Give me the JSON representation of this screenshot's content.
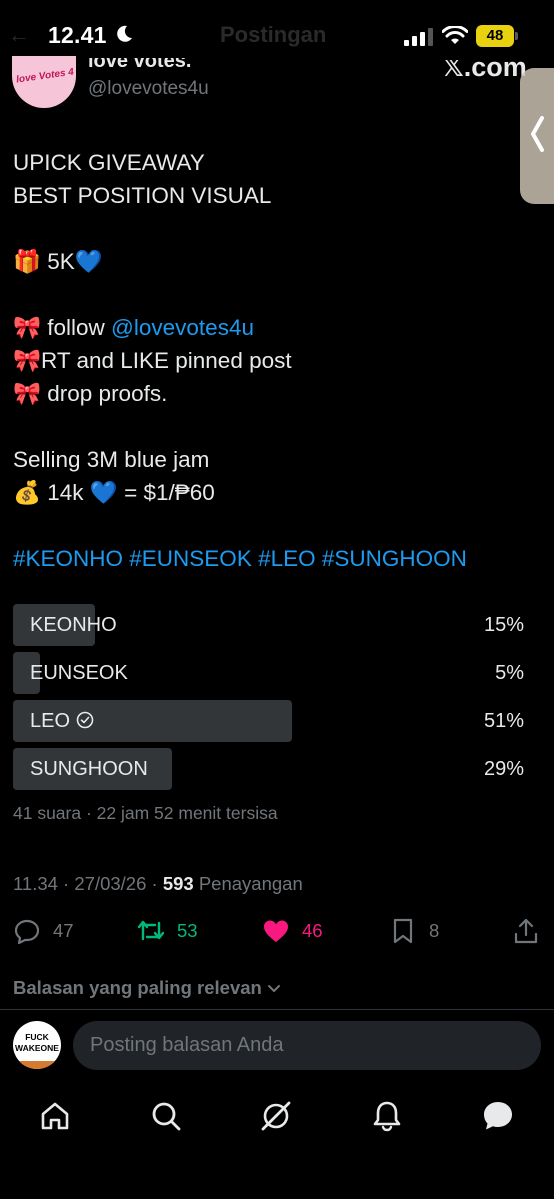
{
  "status_bar": {
    "time": "12.41",
    "battery": "48",
    "ghost_title": "Postingan"
  },
  "tweet_header": {
    "display_name": "love votes.",
    "handle": "@lovevotes4u",
    "avatar_text": "love Votes 4 u",
    "brand": "𝕏.com"
  },
  "tweet": {
    "line1": "UPICK GIVEAWAY",
    "line2": "BEST POSITION VISUAL",
    "prize": "🎁 5K",
    "prize_heart": "💙",
    "step1_prefix": "🎀 follow ",
    "step1_mention": "@lovevotes4u",
    "step2": "🎀RT and LIKE pinned post",
    "step3": "🎀 drop proofs.",
    "selling": "Selling 3M blue jam",
    "price_prefix": "💰 14k ",
    "price_heart": "💙",
    "price_suffix": " = $1/₱60",
    "hashtags": "#KEONHO #EUNSEOK #LEO #SUNGHOON"
  },
  "poll": {
    "options": [
      {
        "label": "KEONHO",
        "percent_text": "15%",
        "share": 0.15,
        "selected": false
      },
      {
        "label": "EUNSEOK",
        "percent_text": "5%",
        "share": 0.05,
        "selected": false
      },
      {
        "label": "LEO",
        "percent_text": "51%",
        "share": 0.51,
        "selected": true
      },
      {
        "label": "SUNGHOON",
        "percent_text": "29%",
        "share": 0.29,
        "selected": false
      }
    ],
    "meta": "41 suara · 22 jam 52 menit tersisa"
  },
  "timestamp": {
    "time": "11.34 · 27/03/26 · ",
    "views": "593",
    "views_label": " Penayangan"
  },
  "actions": {
    "replies": "47",
    "reposts": "53",
    "likes": "46",
    "bookmarks": "8",
    "repost_color": "#00ba7c",
    "like_color": "#f91880"
  },
  "replies_section": {
    "sort_label": "Balasan yang paling relevan"
  },
  "reply_box": {
    "placeholder": "Posting balasan Anda",
    "avatar_text_line1": "FUCK",
    "avatar_text_line2": "WAKEONE"
  },
  "nav": {
    "icons": [
      "home-icon",
      "search-icon",
      "grok-icon",
      "notifications-icon",
      "messages-icon"
    ]
  }
}
